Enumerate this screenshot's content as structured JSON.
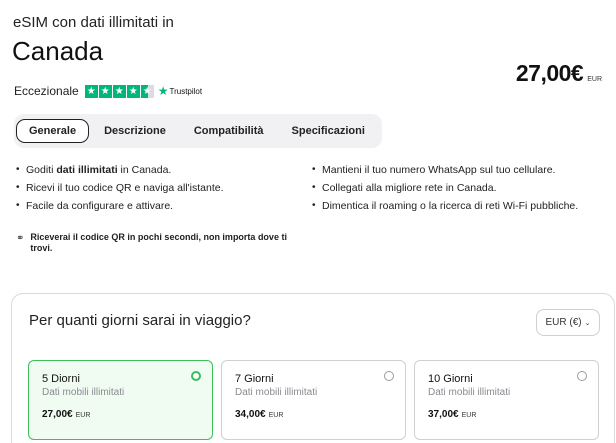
{
  "header": {
    "subtitle": "eSIM con dati illimitati in",
    "title": "Canada",
    "price_amount": "27,00€",
    "price_currency": "EUR"
  },
  "rating": {
    "label": "Eccezionale",
    "stars": 4.5,
    "provider": "Trustpilot"
  },
  "tabs": [
    {
      "label": "Generale",
      "active": true
    },
    {
      "label": "Descrizione",
      "active": false
    },
    {
      "label": "Compatibilità",
      "active": false
    },
    {
      "label": "Specificazioni",
      "active": false
    }
  ],
  "features": {
    "left": [
      {
        "pre": "Goditi ",
        "bold": "dati illimitati",
        "post": " in Canada."
      },
      {
        "pre": "Ricevi il tuo codice QR e naviga all'istante.",
        "bold": "",
        "post": ""
      },
      {
        "pre": "Facile da configurare e attivare.",
        "bold": "",
        "post": ""
      }
    ],
    "right": [
      "Mantieni il tuo numero WhatsApp sul tuo cellulare.",
      "Collegati alla migliore rete in Canada.",
      "Dimentica il roaming o la ricerca di reti Wi-Fi pubbliche."
    ]
  },
  "note": "Riceverai il codice QR in pochi secondi, non importa dove ti trovi.",
  "days_section": {
    "question": "Per quanti giorni sarai in viaggio?",
    "currency_label": "EUR (€)",
    "plans": [
      {
        "days": "5 Diorni",
        "data": "Dati mobili illimitati",
        "price": "27,00€",
        "currency": "EUR",
        "selected": true
      },
      {
        "days": "7 Giorni",
        "data": "Dati mobili illimitati",
        "price": "34,00€",
        "currency": "EUR",
        "selected": false
      },
      {
        "days": "10 Giorni",
        "data": "Dati mobili illimitati",
        "price": "37,00€",
        "currency": "EUR",
        "selected": false
      }
    ]
  },
  "colors": {
    "accent_green": "#3bbf5c",
    "trustpilot_green": "#00b67a",
    "icons": [
      "star-icon",
      "trustpilot-star-icon",
      "tag-icon",
      "radio-icon",
      "chevron-down-icon"
    ]
  }
}
